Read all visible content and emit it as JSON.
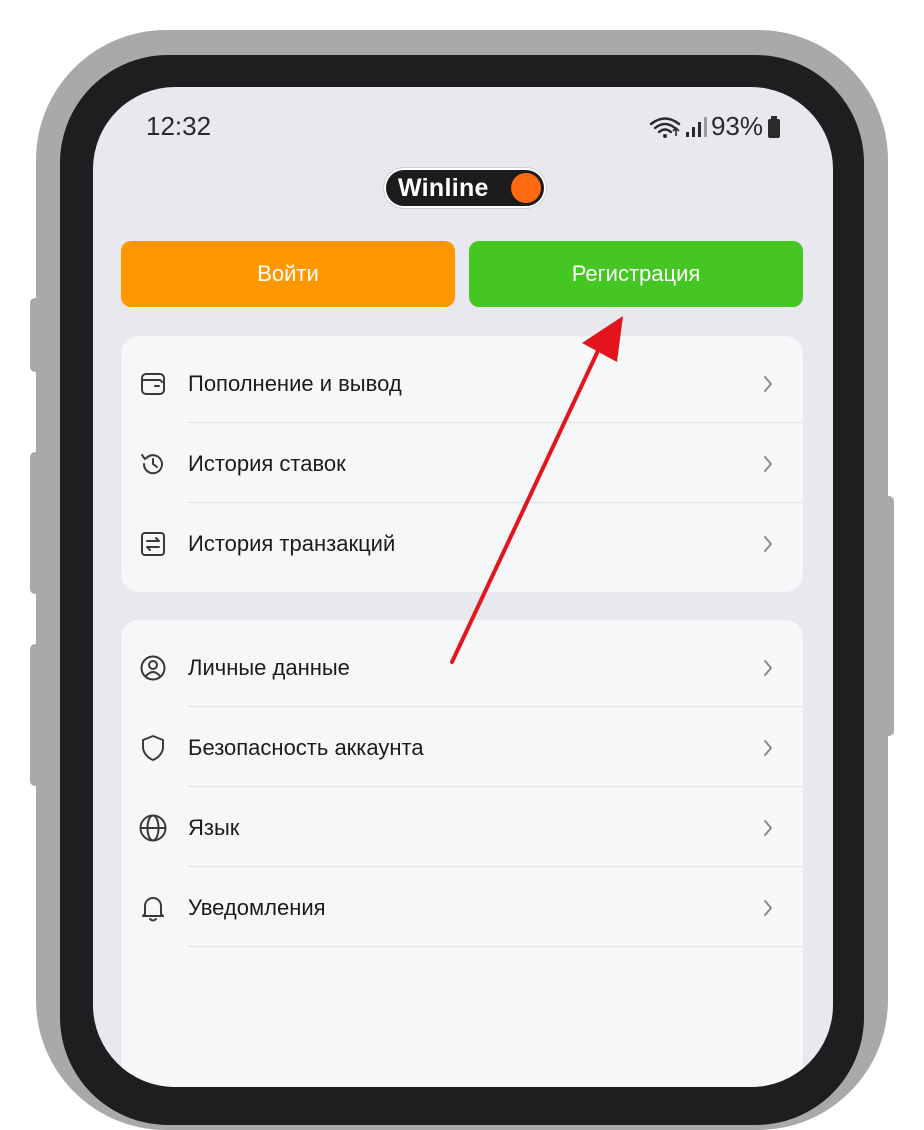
{
  "status_bar": {
    "time": "12:32",
    "battery": "93%"
  },
  "logo": {
    "text": "Winline",
    "dot_color": "#ff6a13"
  },
  "buttons": {
    "login": "Войти",
    "register": "Регистрация",
    "login_color": "#ff9800",
    "register_color": "#46c622"
  },
  "menu_group_1": [
    {
      "label": "Пополнение и вывод",
      "icon": "wallet-icon"
    },
    {
      "label": "История ставок",
      "icon": "history-icon"
    },
    {
      "label": "История транзакций",
      "icon": "transactions-icon"
    }
  ],
  "menu_group_2": [
    {
      "label": "Личные данные",
      "icon": "user-icon"
    },
    {
      "label": "Безопасность аккаунта",
      "icon": "shield-icon"
    },
    {
      "label": "Язык",
      "icon": "globe-icon"
    },
    {
      "label": "Уведомления",
      "icon": "bell-icon"
    }
  ],
  "annotation": {
    "arrow_color": "#e3151c",
    "points_to": "register-button"
  }
}
